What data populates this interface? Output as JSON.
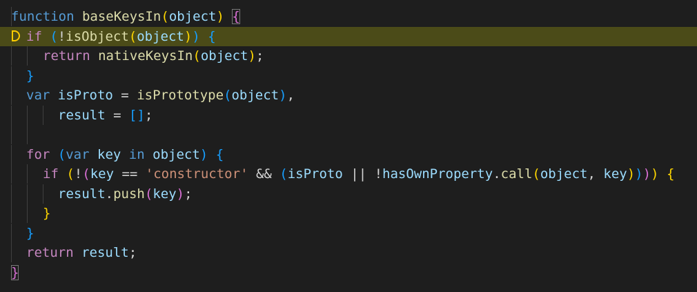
{
  "editor": {
    "colors": {
      "background": "#1e1e1e",
      "line_highlight": "#4b4b18",
      "breakpoint_marker": "#ffcc00"
    },
    "lines": [
      {
        "tokens": [
          {
            "t": "function",
            "c": "kw"
          },
          {
            "t": " ",
            "c": "op"
          },
          {
            "t": "baseKeysIn",
            "c": "fn"
          },
          {
            "t": "(",
            "c": "b1"
          },
          {
            "t": "object",
            "c": "var"
          },
          {
            "t": ")",
            "c": "b1"
          },
          {
            "t": " ",
            "c": "op"
          },
          {
            "t": "{",
            "c": "b2 box"
          }
        ]
      },
      {
        "highlight": true,
        "breakpoint": true,
        "tokens": [
          {
            "t": "if",
            "c": "ctl"
          },
          {
            "t": " ",
            "c": "op"
          },
          {
            "t": "(",
            "c": "b3"
          },
          {
            "t": "!",
            "c": "op"
          },
          {
            "t": "isObject",
            "c": "fn"
          },
          {
            "t": "(",
            "c": "b1"
          },
          {
            "t": "object",
            "c": "var"
          },
          {
            "t": ")",
            "c": "b1"
          },
          {
            "t": ")",
            "c": "b3"
          },
          {
            "t": " ",
            "c": "op"
          },
          {
            "t": "{",
            "c": "b3"
          }
        ]
      },
      {
        "tokens": [
          {
            "t": "return",
            "c": "ctl"
          },
          {
            "t": " ",
            "c": "op"
          },
          {
            "t": "nativeKeysIn",
            "c": "fn"
          },
          {
            "t": "(",
            "c": "b1"
          },
          {
            "t": "object",
            "c": "var"
          },
          {
            "t": ")",
            "c": "b1"
          },
          {
            "t": ";",
            "c": "op"
          }
        ]
      },
      {
        "tokens": [
          {
            "t": "}",
            "c": "b3"
          }
        ]
      },
      {
        "tokens": [
          {
            "t": "var",
            "c": "kw"
          },
          {
            "t": " ",
            "c": "op"
          },
          {
            "t": "isProto",
            "c": "var"
          },
          {
            "t": " = ",
            "c": "op"
          },
          {
            "t": "isPrototype",
            "c": "fn"
          },
          {
            "t": "(",
            "c": "b3"
          },
          {
            "t": "object",
            "c": "var"
          },
          {
            "t": ")",
            "c": "b3"
          },
          {
            "t": ",",
            "c": "op"
          }
        ]
      },
      {
        "tokens": [
          {
            "t": "result",
            "c": "var"
          },
          {
            "t": " = ",
            "c": "op"
          },
          {
            "t": "[]",
            "c": "b3"
          },
          {
            "t": ";",
            "c": "op"
          }
        ]
      },
      {
        "tokens": []
      },
      {
        "tokens": [
          {
            "t": "for",
            "c": "ctl"
          },
          {
            "t": " ",
            "c": "op"
          },
          {
            "t": "(",
            "c": "b3"
          },
          {
            "t": "var",
            "c": "kw"
          },
          {
            "t": " ",
            "c": "op"
          },
          {
            "t": "key",
            "c": "var"
          },
          {
            "t": " ",
            "c": "op"
          },
          {
            "t": "in",
            "c": "kw"
          },
          {
            "t": " ",
            "c": "op"
          },
          {
            "t": "object",
            "c": "var"
          },
          {
            "t": ")",
            "c": "b3"
          },
          {
            "t": " ",
            "c": "op"
          },
          {
            "t": "{",
            "c": "b3"
          }
        ]
      },
      {
        "tokens": [
          {
            "t": "if",
            "c": "ctl"
          },
          {
            "t": " ",
            "c": "op"
          },
          {
            "t": "(",
            "c": "b1"
          },
          {
            "t": "!",
            "c": "op"
          },
          {
            "t": "(",
            "c": "b2"
          },
          {
            "t": "key",
            "c": "var"
          },
          {
            "t": " == ",
            "c": "op"
          },
          {
            "t": "'constructor'",
            "c": "str"
          },
          {
            "t": " && ",
            "c": "op"
          },
          {
            "t": "(",
            "c": "b3"
          },
          {
            "t": "isProto",
            "c": "var"
          },
          {
            "t": " || ",
            "c": "op"
          },
          {
            "t": "!",
            "c": "op"
          },
          {
            "t": "hasOwnProperty",
            "c": "var"
          },
          {
            "t": ".",
            "c": "op"
          },
          {
            "t": "call",
            "c": "fn"
          },
          {
            "t": "(",
            "c": "b1"
          },
          {
            "t": "object",
            "c": "var"
          },
          {
            "t": ", ",
            "c": "op"
          },
          {
            "t": "key",
            "c": "var"
          },
          {
            "t": ")",
            "c": "b1"
          },
          {
            "t": ")",
            "c": "b3"
          },
          {
            "t": ")",
            "c": "b2"
          },
          {
            "t": ")",
            "c": "b1"
          },
          {
            "t": " ",
            "c": "op"
          },
          {
            "t": "{",
            "c": "b1"
          }
        ]
      },
      {
        "tokens": [
          {
            "t": "result",
            "c": "var"
          },
          {
            "t": ".",
            "c": "op"
          },
          {
            "t": "push",
            "c": "fn"
          },
          {
            "t": "(",
            "c": "b2"
          },
          {
            "t": "key",
            "c": "var"
          },
          {
            "t": ")",
            "c": "b2"
          },
          {
            "t": ";",
            "c": "op"
          }
        ]
      },
      {
        "tokens": [
          {
            "t": "}",
            "c": "b1"
          }
        ]
      },
      {
        "tokens": [
          {
            "t": "}",
            "c": "b3"
          }
        ]
      },
      {
        "tokens": [
          {
            "t": "return",
            "c": "ctl"
          },
          {
            "t": " ",
            "c": "op"
          },
          {
            "t": "result",
            "c": "var"
          },
          {
            "t": ";",
            "c": "op"
          }
        ]
      },
      {
        "tokens": [
          {
            "t": "}",
            "c": "b2 box"
          }
        ]
      }
    ]
  }
}
